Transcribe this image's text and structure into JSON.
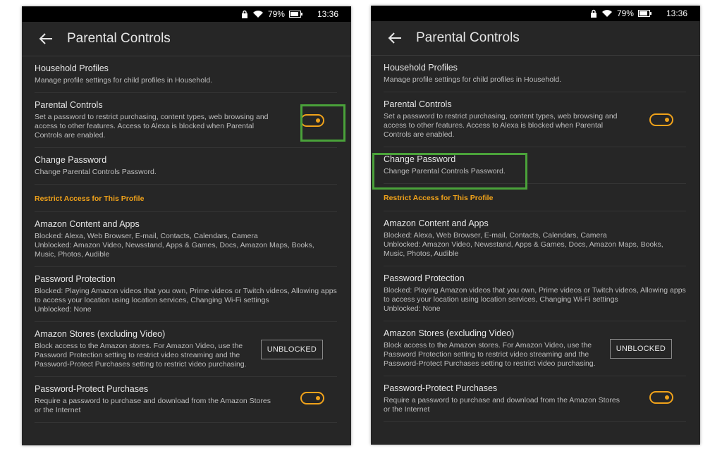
{
  "status": {
    "battery": "79%",
    "time": "13:36"
  },
  "appbar": {
    "title": "Parental Controls"
  },
  "items": {
    "household": {
      "title": "Household Profiles",
      "desc": "Manage profile settings for child profiles in Household."
    },
    "parental": {
      "title": "Parental Controls",
      "desc": "Set a password to restrict purchasing, content types, web browsing and access to other features. Access to Alexa is blocked when Parental Controls are enabled."
    },
    "change_password": {
      "title": "Change Password",
      "desc": "Change Parental Controls Password."
    },
    "section": "Restrict Access for This Profile",
    "content_apps": {
      "title": "Amazon Content and Apps",
      "desc": "Blocked: Alexa, Web Browser, E-mail, Contacts, Calendars, Camera\nUnblocked: Amazon Video, Newsstand, Apps & Games, Docs, Amazon Maps, Books, Music, Photos, Audible"
    },
    "password_protection": {
      "title": "Password Protection",
      "desc": "Blocked: Playing Amazon videos that you own, Prime videos or Twitch videos, Allowing apps to access your location using location services, Changing Wi-Fi settings\nUnblocked: None"
    },
    "stores": {
      "title": "Amazon Stores (excluding Video)",
      "desc": "Block access to the Amazon stores. For Amazon Video, use the Password Protection setting to restrict video streaming and the Password-Protect Purchases setting to restrict video purchasing.",
      "button": "UNBLOCKED"
    },
    "purchases": {
      "title": "Password-Protect Purchases",
      "desc": "Require a password to purchase and download from the Amazon Stores or the Internet"
    }
  },
  "toggles": {
    "parental": true,
    "purchases": true
  },
  "colors": {
    "accent": "#f0a21a",
    "highlight": "#4aa23a",
    "background": "#262626"
  }
}
